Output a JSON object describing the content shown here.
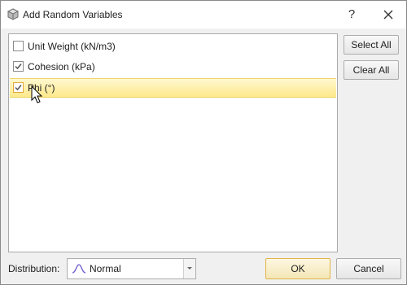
{
  "window": {
    "title": "Add Random Variables",
    "help_label": "?",
    "icon": "app-icon",
    "close_icon": "close-icon"
  },
  "variables": [
    {
      "label": "Unit Weight (kN/m3)",
      "checked": false,
      "selected": false
    },
    {
      "label": "Cohesion (kPa)",
      "checked": true,
      "selected": false
    },
    {
      "label": "Phi (°)",
      "checked": true,
      "selected": true
    }
  ],
  "side_buttons": {
    "select_all": "Select All",
    "clear_all": "Clear All"
  },
  "distribution": {
    "label": "Distribution:",
    "value": "Normal",
    "icon": "bell-curve-icon"
  },
  "footer": {
    "ok": "OK",
    "cancel": "Cancel"
  },
  "colors": {
    "selection": "#fde98b",
    "accent": "#e0b54a",
    "curve": "#6a5acd"
  }
}
